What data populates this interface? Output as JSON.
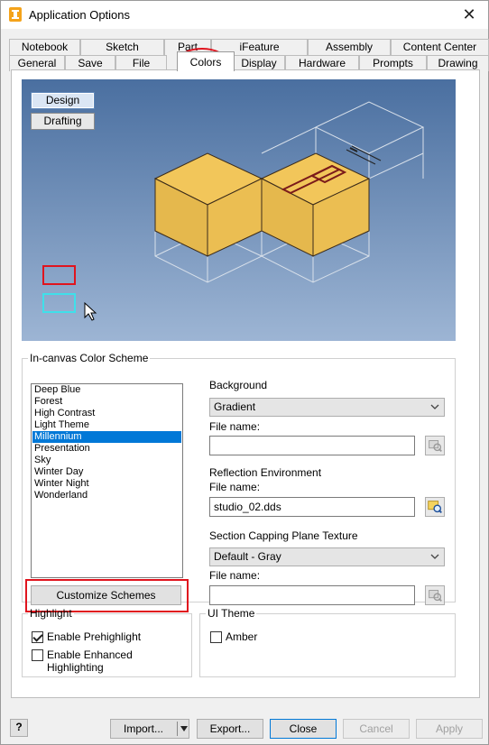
{
  "window": {
    "title": "Application Options",
    "close_glyph": "✕"
  },
  "tabs_back": [
    "Notebook",
    "Sketch",
    "Part",
    "iFeature",
    "Assembly",
    "Content Center"
  ],
  "tabs_front": [
    "General",
    "Save",
    "File",
    "Colors",
    "Display",
    "Hardware",
    "Prompts",
    "Drawing"
  ],
  "active_tab": "Colors",
  "preview": {
    "modes": [
      "Design",
      "Drafting"
    ],
    "selected_mode": "Design"
  },
  "color_scheme": {
    "legend": "In-canvas Color Scheme",
    "items": [
      "Deep Blue",
      "Forest",
      "High Contrast",
      "Light Theme",
      "Millennium",
      "Presentation",
      "Sky",
      "Winter Day",
      "Winter Night",
      "Wonderland"
    ],
    "selected": "Millennium",
    "customize_label": "Customize Schemes"
  },
  "background": {
    "label": "Background",
    "value": "Gradient",
    "file_label": "File name:",
    "file_value": ""
  },
  "reflection": {
    "label": "Reflection Environment",
    "file_label": "File name:",
    "file_value": "studio_02.dds"
  },
  "section_capping": {
    "label": "Section Capping Plane Texture",
    "value": "Default - Gray",
    "file_label": "File name:",
    "file_value": ""
  },
  "highlight": {
    "legend": "Highlight",
    "prehighlight_label": "Enable Prehighlight",
    "prehighlight_checked": true,
    "enhanced_label": "Enable Enhanced Highlighting",
    "enhanced_checked": false
  },
  "ui_theme": {
    "legend": "UI Theme",
    "amber_label": "Amber",
    "amber_checked": false
  },
  "footer": {
    "help_glyph": "?",
    "import_label": "Import...",
    "export_label": "Export...",
    "close_label": "Close",
    "cancel_label": "Cancel",
    "apply_label": "Apply"
  },
  "colors": {
    "accent": "#0078d7",
    "annotation_red": "#e0141e",
    "cube_face_light": "#f2c65a",
    "cube_face_dark": "#e5b84d"
  }
}
